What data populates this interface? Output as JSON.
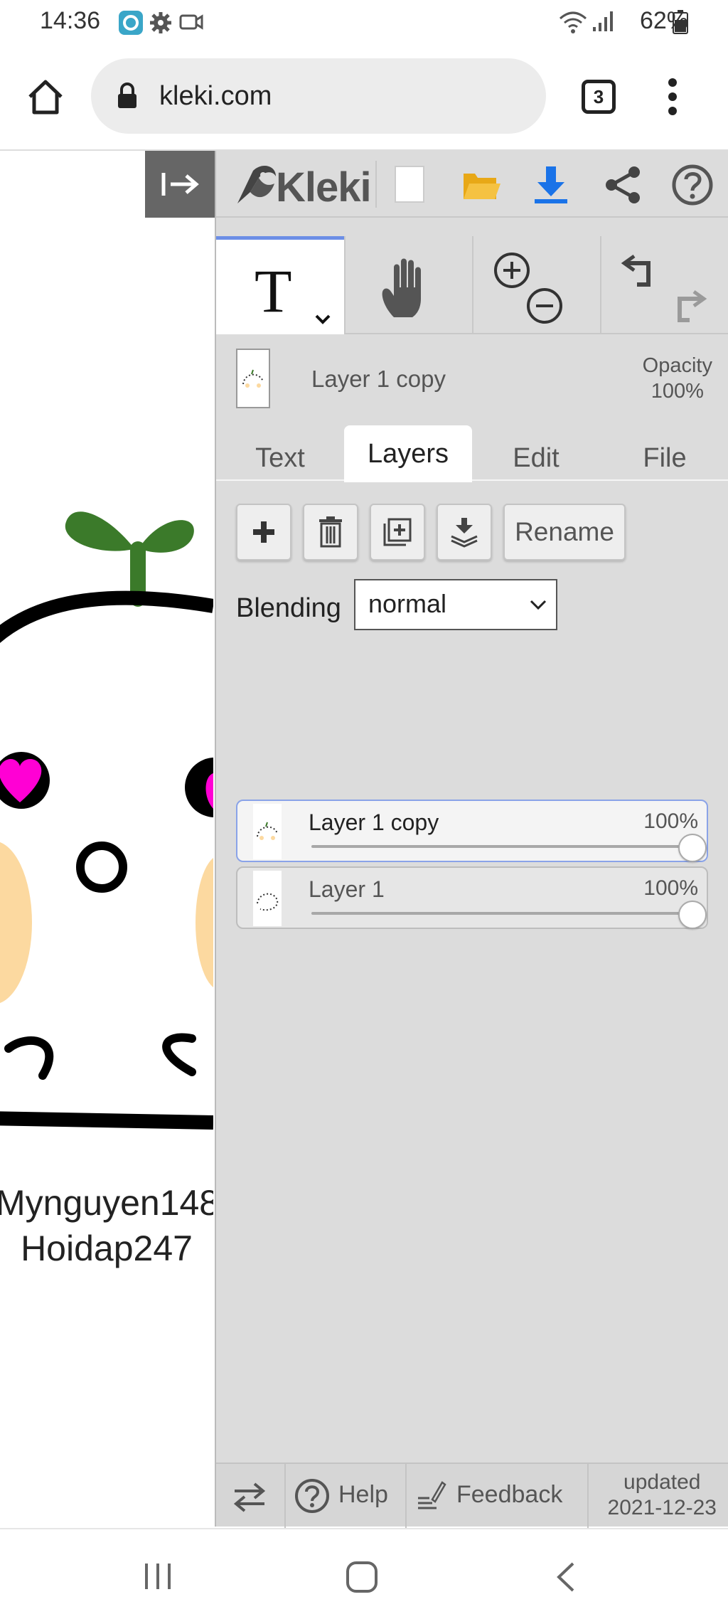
{
  "status_bar": {
    "time": "14:36",
    "battery": "62%"
  },
  "browser": {
    "url": "kleki.com",
    "tab_count": "3"
  },
  "canvas": {
    "text_line1": "Mynguyen148",
    "text_line2": "Hoidap247"
  },
  "app": {
    "name": "Kleki",
    "current_layer_name": "Layer 1 copy",
    "opacity_label": "Opacity",
    "opacity_value": "100%"
  },
  "tabs": [
    {
      "label": "Text",
      "active": false
    },
    {
      "label": "Layers",
      "active": true
    },
    {
      "label": "Edit",
      "active": false
    },
    {
      "label": "File",
      "active": false
    }
  ],
  "layer_tools": {
    "rename_label": "Rename"
  },
  "blending": {
    "label": "Blending",
    "value": "normal"
  },
  "layers": [
    {
      "name": "Layer 1 copy",
      "opacity": "100%",
      "opacity_fraction": 1.0,
      "selected": true
    },
    {
      "name": "Layer 1",
      "opacity": "100%",
      "opacity_fraction": 1.0,
      "selected": false
    }
  ],
  "footer": {
    "help_label": "Help",
    "feedback_label": "Feedback",
    "updated_label": "updated",
    "updated_date": "2021-12-23"
  },
  "colors": {
    "accent": "#6c8ee6",
    "download_blue": "#1a73e8",
    "folder_yellow": "#f5c242",
    "sprout_green": "#3b7a2a",
    "heart_pink": "#ff00d4",
    "cheek_peach": "#fcd9a0"
  }
}
